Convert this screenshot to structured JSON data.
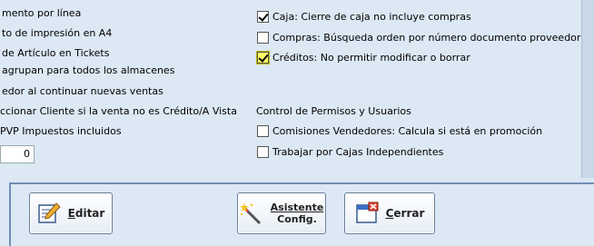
{
  "left_options": [
    "mento por línea",
    "to de impresión en A4",
    "de Artículo en Tickets",
    "agrupan para todos los almacenes",
    "edor al continuar nuevas ventas",
    "ccionar Cliente si la venta no es Crédito/A Vista",
    "PVP Impuestos incluidos"
  ],
  "numeric_field_value": "0",
  "right_options": [
    {
      "label": "Caja: Cierre de caja no incluye compras",
      "checked": true
    },
    {
      "label": "Compras: Búsqueda orden por número documento proveedor",
      "checked": false
    },
    {
      "label": "Créditos: No permitir modificar o borrar",
      "checked": true,
      "highlighted": true
    }
  ],
  "permissions_section_title": "Control de Permisos y Usuarios",
  "permissions_options": [
    {
      "label": "Comisiones Vendedores: Calcula si está en promoción",
      "checked": false
    },
    {
      "label": "Trabajar por Cajas Independientes",
      "checked": false
    }
  ],
  "buttons": {
    "edit_label_first": "E",
    "edit_label_rest": "ditar",
    "wizard_line1": "Asistente",
    "wizard_line2": "Config.",
    "close_label_first": "C",
    "close_label_rest": "errar"
  }
}
